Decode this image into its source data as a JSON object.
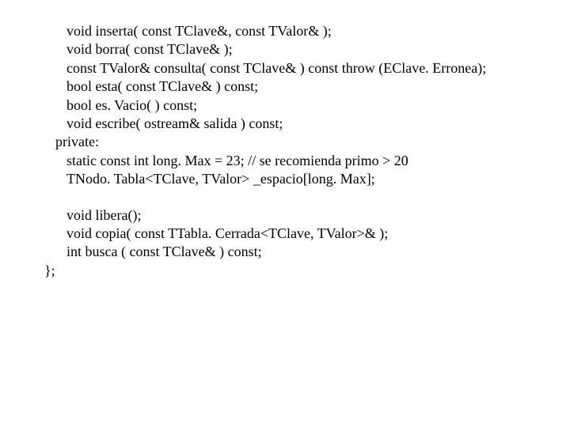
{
  "code": {
    "lines": [
      {
        "indent": 2,
        "text": "void inserta( const TClave&, const TValor& );"
      },
      {
        "indent": 2,
        "text": "void borra( const TClave& );"
      },
      {
        "indent": 2,
        "text": "const TValor& consulta( const TClave& ) const throw (EClave. Erronea);"
      },
      {
        "indent": 2,
        "text": "bool esta( const TClave& ) const;"
      },
      {
        "indent": 2,
        "text": "bool es. Vacio( ) const;"
      },
      {
        "indent": 2,
        "text": "void escribe( ostream& salida ) const;"
      },
      {
        "indent": 1,
        "text": "private:"
      },
      {
        "indent": 2,
        "text": "static const int long. Max = 23; // se recomienda primo > 20"
      },
      {
        "indent": 2,
        "text": "TNodo. Tabla<TClave, TValor> _espacio[long. Max];"
      },
      {
        "indent": 0,
        "text": "",
        "gap": true
      },
      {
        "indent": 2,
        "text": "void libera();"
      },
      {
        "indent": 2,
        "text": "void copia( const TTabla. Cerrada<TClave, TValor>& );"
      },
      {
        "indent": 2,
        "text": "int busca ( const TClave& ) const;"
      },
      {
        "indent": 0,
        "text": "};"
      }
    ]
  }
}
